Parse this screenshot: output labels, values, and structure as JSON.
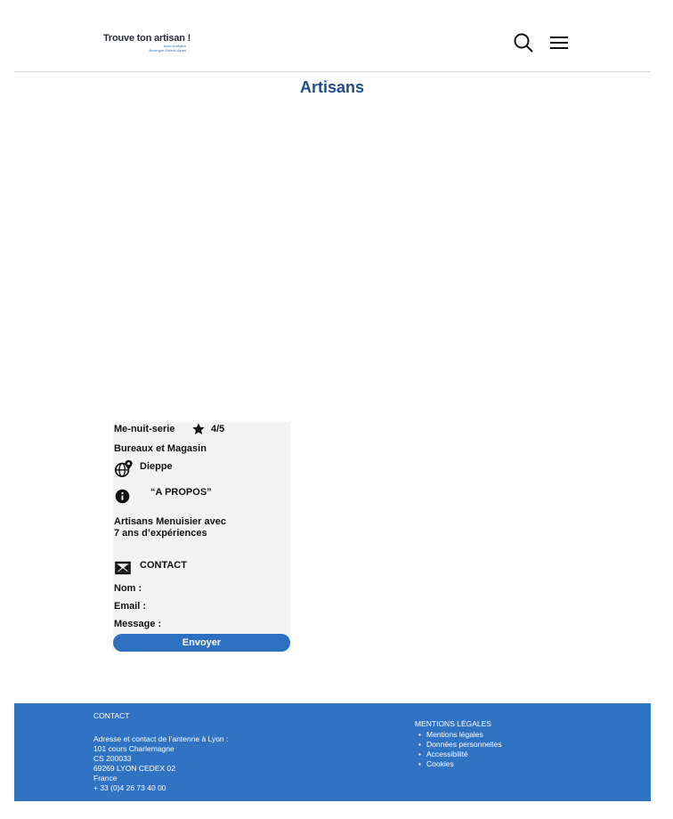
{
  "header": {
    "logo_title": "Trouve ton artisan !",
    "logo_sub1": "Avec la région",
    "logo_sub2": "Auvergne-Rhône-Alpes",
    "search_icon": "search-icon",
    "menu_icon": "hamburger-menu-icon"
  },
  "page": {
    "title": "Artisans"
  },
  "card": {
    "name": "Me-nuit-serie",
    "rating": "4/5",
    "rating_icon": "star-icon",
    "category": "Bureaux et Magasin",
    "location": "Dieppe",
    "about_label": "“A PROPOS”",
    "about_text_line1": "Artisans Menuisier avec",
    "about_text_line2": "7 ans d’expériences",
    "contact_label": "CONTACT",
    "name_label": "Nom :",
    "email_label": "Email :",
    "message_label": "Message :",
    "send_label": "Envoyer"
  },
  "footer": {
    "contact_heading": "CONTACT",
    "address_intro": "Adresse et contact de l’antenne à Lyon :",
    "address_line1": "101 cours Charlemagne",
    "address_line2": "CS 200033",
    "address_line3": "69269 LYON CEDEX 02",
    "address_line4": "France",
    "phone": "+ 33 (0)4 26 73 40 00",
    "legal_heading": "MENTIONS LÉGALES",
    "legal_links": [
      "Mentions légales",
      "Données personnelles",
      "Accessibilité",
      "Cookies"
    ]
  },
  "colors": {
    "title_blue": "#1d4f86",
    "button_blue": "#2d6fc0",
    "footer_blue": "#3073c3",
    "card_bg": "#f3f3f3"
  }
}
